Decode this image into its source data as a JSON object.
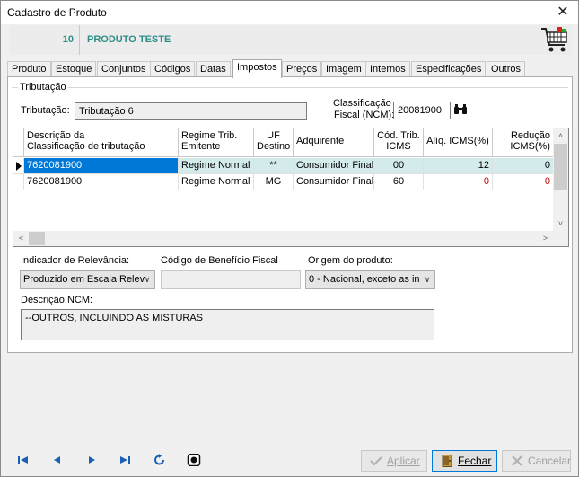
{
  "window": {
    "title": "Cadastro de Produto",
    "close_glyph": "✕"
  },
  "product": {
    "code": "10",
    "name": "PRODUTO TESTE"
  },
  "tabs": [
    {
      "label": "Produto"
    },
    {
      "label": "Estoque"
    },
    {
      "label": "Conjuntos"
    },
    {
      "label": "Códigos"
    },
    {
      "label": "Datas"
    },
    {
      "label": "Impostos"
    },
    {
      "label": "Preços"
    },
    {
      "label": "Imagem"
    },
    {
      "label": "Internos"
    },
    {
      "label": "Especificações"
    },
    {
      "label": "Outros"
    }
  ],
  "active_tab": "Impostos",
  "tributacao_group": {
    "title": "Tributação",
    "tributacao_label": "Tributação:",
    "tributacao_value": "Tributação 6",
    "ncm_label_line1": "Classificação",
    "ncm_label_line2": "Fiscal (NCM):",
    "ncm_value": "20081900"
  },
  "grid": {
    "columns": [
      {
        "line1": "Descrição da",
        "line2": "Classificação de tributação"
      },
      {
        "line1": "Regime Trib.",
        "line2": "Emitente"
      },
      {
        "line1": "UF",
        "line2": "Destino"
      },
      {
        "line1": "Adquirente",
        "line2": ""
      },
      {
        "line1": "Cód. Trib.",
        "line2": "ICMS"
      },
      {
        "line1": "Alíq. ICMS(%)",
        "line2": ""
      },
      {
        "line1": "Redução",
        "line2": "ICMS(%)"
      }
    ],
    "rows": [
      {
        "desc": "7620081900",
        "regime": "Regime Normal",
        "uf": "**",
        "adquirente": "Consumidor Final",
        "cod": "00",
        "aliq": "12",
        "reducao": "0"
      },
      {
        "desc": "7620081900",
        "regime": "Regime Normal",
        "uf": "MG",
        "adquirente": "Consumidor Final",
        "cod": "60",
        "aliq": "0",
        "reducao": "0"
      }
    ]
  },
  "indicador": {
    "label": "Indicador de Relevância:",
    "value": "Produzido em Escala Relev"
  },
  "beneficio": {
    "label": "Código de Benefício Fiscal",
    "value": ""
  },
  "origem": {
    "label": "Origem do produto:",
    "value": "0 - Nacional, exceto as in"
  },
  "descricao_ncm": {
    "label": "Descrição NCM:",
    "value": "--OUTROS, INCLUINDO AS MISTURAS"
  },
  "footer": {
    "aplicar": "Aplicar",
    "fechar": "Fechar",
    "cancelar": "Cancelar"
  },
  "colors": {
    "accent": "#2e8f88",
    "selection": "#0078d7",
    "negative": "#c00000"
  }
}
